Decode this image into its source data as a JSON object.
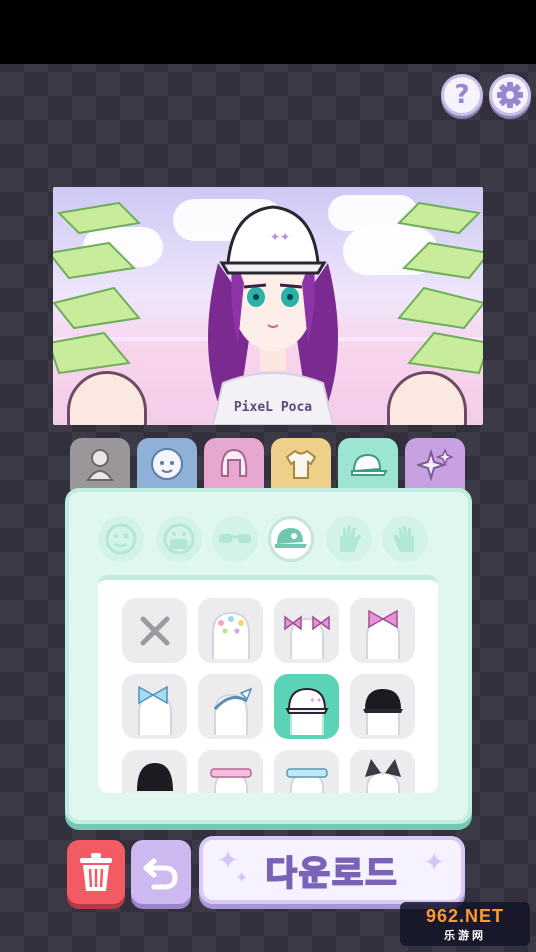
{
  "toolbar": {
    "help_label": "?",
    "settings_icon": "gear-icon"
  },
  "preview": {
    "shirt_text": "PixeL Poca"
  },
  "tabs": [
    {
      "name": "body",
      "icon": "silhouette-icon",
      "color": "#9a969a"
    },
    {
      "name": "face",
      "icon": "face-icon",
      "color": "#8fb1d8"
    },
    {
      "name": "hair",
      "icon": "hair-icon",
      "color": "#e7a8cf"
    },
    {
      "name": "clothes",
      "icon": "shirt-icon",
      "color": "#efd08a"
    },
    {
      "name": "accessories",
      "icon": "cap-icon",
      "color": "#9de4d2"
    },
    {
      "name": "effects",
      "icon": "sparkle-icon",
      "color": "#c8a2e0"
    }
  ],
  "subcategories": [
    "face-sticker-icon",
    "mask-icon",
    "glasses-icon",
    "cap-icon",
    "left-hand-icon",
    "right-hand-icon"
  ],
  "items": [
    "none",
    "sparkle-clips",
    "pink-bows-pair",
    "pink-bow",
    "blue-bow",
    "headband",
    "white-cap",
    "black-cap",
    "black-beanie",
    "pink-visor",
    "blue-visor",
    "cat-ears"
  ],
  "actions": {
    "download_label": "다운로드"
  },
  "watermark": {
    "line1": "962.NET",
    "line2": "乐游网"
  },
  "colors": {
    "accent": "#5cd3b7",
    "danger": "#f25b64",
    "purple": "#cdb9f0"
  }
}
